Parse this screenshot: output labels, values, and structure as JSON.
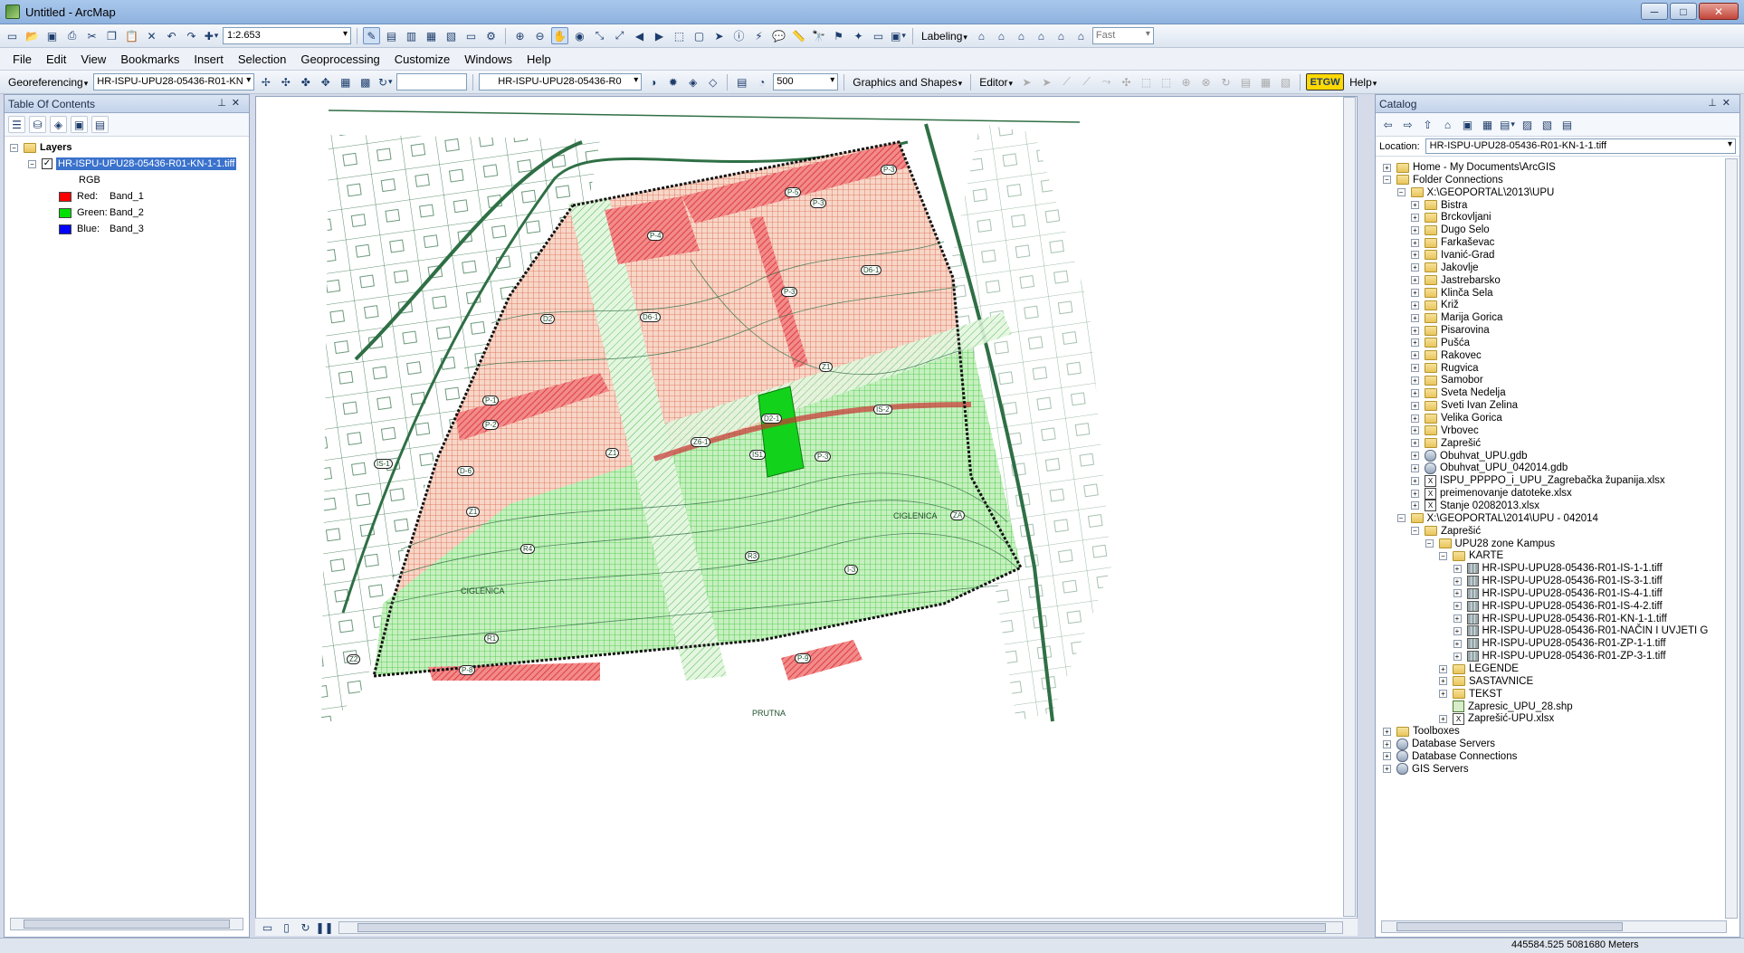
{
  "window": {
    "title": "Untitled - ArcMap",
    "minimize": "─",
    "maximize": "□",
    "close": "✕"
  },
  "toolbar": {
    "scale": "1:2.653",
    "labeling": "Labeling",
    "fast": "Fast"
  },
  "menu": [
    "File",
    "Edit",
    "View",
    "Bookmarks",
    "Insert",
    "Selection",
    "Geoprocessing",
    "Customize",
    "Windows",
    "Help"
  ],
  "georef": {
    "label": "Georeferencing",
    "layer": "HR-ISPU-UPU28-05436-R01-KN",
    "raster": "HR-ISPU-UPU28-05436-R0",
    "value": "500",
    "graphics": "Graphics and Shapes",
    "editor": "Editor",
    "help": "Help"
  },
  "toc": {
    "title": "Table Of Contents",
    "root": "Layers",
    "layer": "HR-ISPU-UPU28-05436-R01-KN-1-1.tiff",
    "rgb": "RGB",
    "bands": [
      {
        "label": "Red:",
        "band": "Band_1",
        "color": "#ff0000"
      },
      {
        "label": "Green:",
        "band": "Band_2",
        "color": "#00e000"
      },
      {
        "label": "Blue:",
        "band": "Band_3",
        "color": "#0000ff"
      }
    ]
  },
  "map": {
    "labels": [
      "P-3",
      "P-5",
      "P-3",
      "P-4",
      "P-3",
      "D6-1",
      "D6-1",
      "D2",
      "Z1",
      "P-1",
      "P-2",
      "D2-1",
      "Z1",
      "Z6-1",
      "IS-2",
      "IS1",
      "P-3",
      "D-6",
      "IS-1",
      "Z1",
      "R4",
      "R3",
      "I-3",
      "ZA",
      "Z2",
      "R1",
      "P-8",
      "P-9",
      "CIGLENICA",
      "CIGLENICA",
      "PRUTNA"
    ]
  },
  "catalog": {
    "title": "Catalog",
    "location_label": "Location:",
    "location": "HR-ISPU-UPU28-05436-R01-KN-1-1.tiff",
    "items": [
      {
        "t": "Home - My Documents\\ArcGIS",
        "i": "f",
        "l": 0,
        "e": "+"
      },
      {
        "t": "Folder Connections",
        "i": "f",
        "l": 0,
        "e": "-"
      },
      {
        "t": "X:\\GEOPORTAL\\2013\\UPU",
        "i": "f",
        "l": 1,
        "e": "-"
      },
      {
        "t": "Bistra",
        "i": "f",
        "l": 2,
        "e": "+"
      },
      {
        "t": "Brckovljani",
        "i": "f",
        "l": 2,
        "e": "+"
      },
      {
        "t": "Dugo Selo",
        "i": "f",
        "l": 2,
        "e": "+"
      },
      {
        "t": "Farkaševac",
        "i": "f",
        "l": 2,
        "e": "+"
      },
      {
        "t": "Ivanić-Grad",
        "i": "f",
        "l": 2,
        "e": "+"
      },
      {
        "t": "Jakovlje",
        "i": "f",
        "l": 2,
        "e": "+"
      },
      {
        "t": "Jastrebarsko",
        "i": "f",
        "l": 2,
        "e": "+"
      },
      {
        "t": "Klinča Sela",
        "i": "f",
        "l": 2,
        "e": "+"
      },
      {
        "t": "Križ",
        "i": "f",
        "l": 2,
        "e": "+"
      },
      {
        "t": "Marija Gorica",
        "i": "f",
        "l": 2,
        "e": "+"
      },
      {
        "t": "Pisarovina",
        "i": "f",
        "l": 2,
        "e": "+"
      },
      {
        "t": "Pušća",
        "i": "f",
        "l": 2,
        "e": "+"
      },
      {
        "t": "Rakovec",
        "i": "f",
        "l": 2,
        "e": "+"
      },
      {
        "t": "Rugvica",
        "i": "f",
        "l": 2,
        "e": "+"
      },
      {
        "t": "Samobor",
        "i": "f",
        "l": 2,
        "e": "+"
      },
      {
        "t": "Sveta Nedelja",
        "i": "f",
        "l": 2,
        "e": "+"
      },
      {
        "t": "Sveti Ivan Zelina",
        "i": "f",
        "l": 2,
        "e": "+"
      },
      {
        "t": "Velika Gorica",
        "i": "f",
        "l": 2,
        "e": "+"
      },
      {
        "t": "Vrbovec",
        "i": "f",
        "l": 2,
        "e": "+"
      },
      {
        "t": "Zaprešić",
        "i": "f",
        "l": 2,
        "e": "+"
      },
      {
        "t": "Obuhvat_UPU.gdb",
        "i": "d",
        "l": 2,
        "e": "+"
      },
      {
        "t": "Obuhvat_UPU_042014.gdb",
        "i": "d",
        "l": 2,
        "e": "+"
      },
      {
        "t": "ISPU_PPPPO_i_UPU_Zagrebačka županija.xlsx",
        "i": "x",
        "l": 2,
        "e": "+"
      },
      {
        "t": "preimenovanje datoteke.xlsx",
        "i": "x",
        "l": 2,
        "e": "+"
      },
      {
        "t": "Stanje 02082013.xlsx",
        "i": "x",
        "l": 2,
        "e": "+"
      },
      {
        "t": "X:\\GEOPORTAL\\2014\\UPU - 042014",
        "i": "f",
        "l": 1,
        "e": "-"
      },
      {
        "t": "Zaprešić",
        "i": "f",
        "l": 2,
        "e": "-"
      },
      {
        "t": "UPU28 zone Kampus",
        "i": "f",
        "l": 3,
        "e": "-"
      },
      {
        "t": "KARTE",
        "i": "f",
        "l": 4,
        "e": "-"
      },
      {
        "t": "HR-ISPU-UPU28-05436-R01-IS-1-1.tiff",
        "i": "g",
        "l": 5,
        "e": "+"
      },
      {
        "t": "HR-ISPU-UPU28-05436-R01-IS-3-1.tiff",
        "i": "g",
        "l": 5,
        "e": "+"
      },
      {
        "t": "HR-ISPU-UPU28-05436-R01-IS-4-1.tiff",
        "i": "g",
        "l": 5,
        "e": "+"
      },
      {
        "t": "HR-ISPU-UPU28-05436-R01-IS-4-2.tiff",
        "i": "g",
        "l": 5,
        "e": "+"
      },
      {
        "t": "HR-ISPU-UPU28-05436-R01-KN-1-1.tiff",
        "i": "g",
        "l": 5,
        "e": "+"
      },
      {
        "t": "HR-ISPU-UPU28-05436-R01-NAČIN I UVJETI G",
        "i": "g",
        "l": 5,
        "e": "+"
      },
      {
        "t": "HR-ISPU-UPU28-05436-R01-ZP-1-1.tiff",
        "i": "g",
        "l": 5,
        "e": "+"
      },
      {
        "t": "HR-ISPU-UPU28-05436-R01-ZP-3-1.tiff",
        "i": "g",
        "l": 5,
        "e": "+"
      },
      {
        "t": "LEGENDE",
        "i": "f",
        "l": 4,
        "e": "+"
      },
      {
        "t": "SASTAVNICE",
        "i": "f",
        "l": 4,
        "e": "+"
      },
      {
        "t": "TEKST",
        "i": "f",
        "l": 4,
        "e": "+"
      },
      {
        "t": "Zapresic_UPU_28.shp",
        "i": "s",
        "l": 4,
        "e": ""
      },
      {
        "t": "Zaprešić-UPU.xlsx",
        "i": "x",
        "l": 4,
        "e": "+"
      },
      {
        "t": "Toolboxes",
        "i": "f",
        "l": 0,
        "e": "+"
      },
      {
        "t": "Database Servers",
        "i": "d",
        "l": 0,
        "e": "+"
      },
      {
        "t": "Database Connections",
        "i": "d",
        "l": 0,
        "e": "+"
      },
      {
        "t": "GIS Servers",
        "i": "d",
        "l": 0,
        "e": "+"
      }
    ]
  },
  "status": {
    "coords": "445584.525  5081680 Meters"
  }
}
